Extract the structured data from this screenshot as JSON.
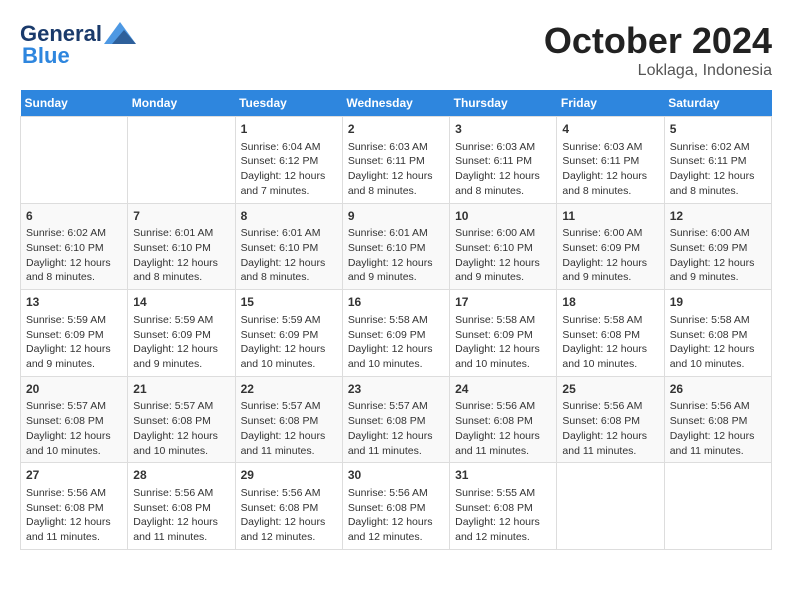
{
  "header": {
    "logo_line1": "General",
    "logo_line2": "Blue",
    "month": "October 2024",
    "location": "Loklaga, Indonesia"
  },
  "weekdays": [
    "Sunday",
    "Monday",
    "Tuesday",
    "Wednesday",
    "Thursday",
    "Friday",
    "Saturday"
  ],
  "weeks": [
    [
      {
        "day": "",
        "info": ""
      },
      {
        "day": "",
        "info": ""
      },
      {
        "day": "1",
        "info": "Sunrise: 6:04 AM\nSunset: 6:12 PM\nDaylight: 12 hours and 7 minutes."
      },
      {
        "day": "2",
        "info": "Sunrise: 6:03 AM\nSunset: 6:11 PM\nDaylight: 12 hours and 8 minutes."
      },
      {
        "day": "3",
        "info": "Sunrise: 6:03 AM\nSunset: 6:11 PM\nDaylight: 12 hours and 8 minutes."
      },
      {
        "day": "4",
        "info": "Sunrise: 6:03 AM\nSunset: 6:11 PM\nDaylight: 12 hours and 8 minutes."
      },
      {
        "day": "5",
        "info": "Sunrise: 6:02 AM\nSunset: 6:11 PM\nDaylight: 12 hours and 8 minutes."
      }
    ],
    [
      {
        "day": "6",
        "info": "Sunrise: 6:02 AM\nSunset: 6:10 PM\nDaylight: 12 hours and 8 minutes."
      },
      {
        "day": "7",
        "info": "Sunrise: 6:01 AM\nSunset: 6:10 PM\nDaylight: 12 hours and 8 minutes."
      },
      {
        "day": "8",
        "info": "Sunrise: 6:01 AM\nSunset: 6:10 PM\nDaylight: 12 hours and 8 minutes."
      },
      {
        "day": "9",
        "info": "Sunrise: 6:01 AM\nSunset: 6:10 PM\nDaylight: 12 hours and 9 minutes."
      },
      {
        "day": "10",
        "info": "Sunrise: 6:00 AM\nSunset: 6:10 PM\nDaylight: 12 hours and 9 minutes."
      },
      {
        "day": "11",
        "info": "Sunrise: 6:00 AM\nSunset: 6:09 PM\nDaylight: 12 hours and 9 minutes."
      },
      {
        "day": "12",
        "info": "Sunrise: 6:00 AM\nSunset: 6:09 PM\nDaylight: 12 hours and 9 minutes."
      }
    ],
    [
      {
        "day": "13",
        "info": "Sunrise: 5:59 AM\nSunset: 6:09 PM\nDaylight: 12 hours and 9 minutes."
      },
      {
        "day": "14",
        "info": "Sunrise: 5:59 AM\nSunset: 6:09 PM\nDaylight: 12 hours and 9 minutes."
      },
      {
        "day": "15",
        "info": "Sunrise: 5:59 AM\nSunset: 6:09 PM\nDaylight: 12 hours and 10 minutes."
      },
      {
        "day": "16",
        "info": "Sunrise: 5:58 AM\nSunset: 6:09 PM\nDaylight: 12 hours and 10 minutes."
      },
      {
        "day": "17",
        "info": "Sunrise: 5:58 AM\nSunset: 6:09 PM\nDaylight: 12 hours and 10 minutes."
      },
      {
        "day": "18",
        "info": "Sunrise: 5:58 AM\nSunset: 6:08 PM\nDaylight: 12 hours and 10 minutes."
      },
      {
        "day": "19",
        "info": "Sunrise: 5:58 AM\nSunset: 6:08 PM\nDaylight: 12 hours and 10 minutes."
      }
    ],
    [
      {
        "day": "20",
        "info": "Sunrise: 5:57 AM\nSunset: 6:08 PM\nDaylight: 12 hours and 10 minutes."
      },
      {
        "day": "21",
        "info": "Sunrise: 5:57 AM\nSunset: 6:08 PM\nDaylight: 12 hours and 10 minutes."
      },
      {
        "day": "22",
        "info": "Sunrise: 5:57 AM\nSunset: 6:08 PM\nDaylight: 12 hours and 11 minutes."
      },
      {
        "day": "23",
        "info": "Sunrise: 5:57 AM\nSunset: 6:08 PM\nDaylight: 12 hours and 11 minutes."
      },
      {
        "day": "24",
        "info": "Sunrise: 5:56 AM\nSunset: 6:08 PM\nDaylight: 12 hours and 11 minutes."
      },
      {
        "day": "25",
        "info": "Sunrise: 5:56 AM\nSunset: 6:08 PM\nDaylight: 12 hours and 11 minutes."
      },
      {
        "day": "26",
        "info": "Sunrise: 5:56 AM\nSunset: 6:08 PM\nDaylight: 12 hours and 11 minutes."
      }
    ],
    [
      {
        "day": "27",
        "info": "Sunrise: 5:56 AM\nSunset: 6:08 PM\nDaylight: 12 hours and 11 minutes."
      },
      {
        "day": "28",
        "info": "Sunrise: 5:56 AM\nSunset: 6:08 PM\nDaylight: 12 hours and 11 minutes."
      },
      {
        "day": "29",
        "info": "Sunrise: 5:56 AM\nSunset: 6:08 PM\nDaylight: 12 hours and 12 minutes."
      },
      {
        "day": "30",
        "info": "Sunrise: 5:56 AM\nSunset: 6:08 PM\nDaylight: 12 hours and 12 minutes."
      },
      {
        "day": "31",
        "info": "Sunrise: 5:55 AM\nSunset: 6:08 PM\nDaylight: 12 hours and 12 minutes."
      },
      {
        "day": "",
        "info": ""
      },
      {
        "day": "",
        "info": ""
      }
    ]
  ]
}
